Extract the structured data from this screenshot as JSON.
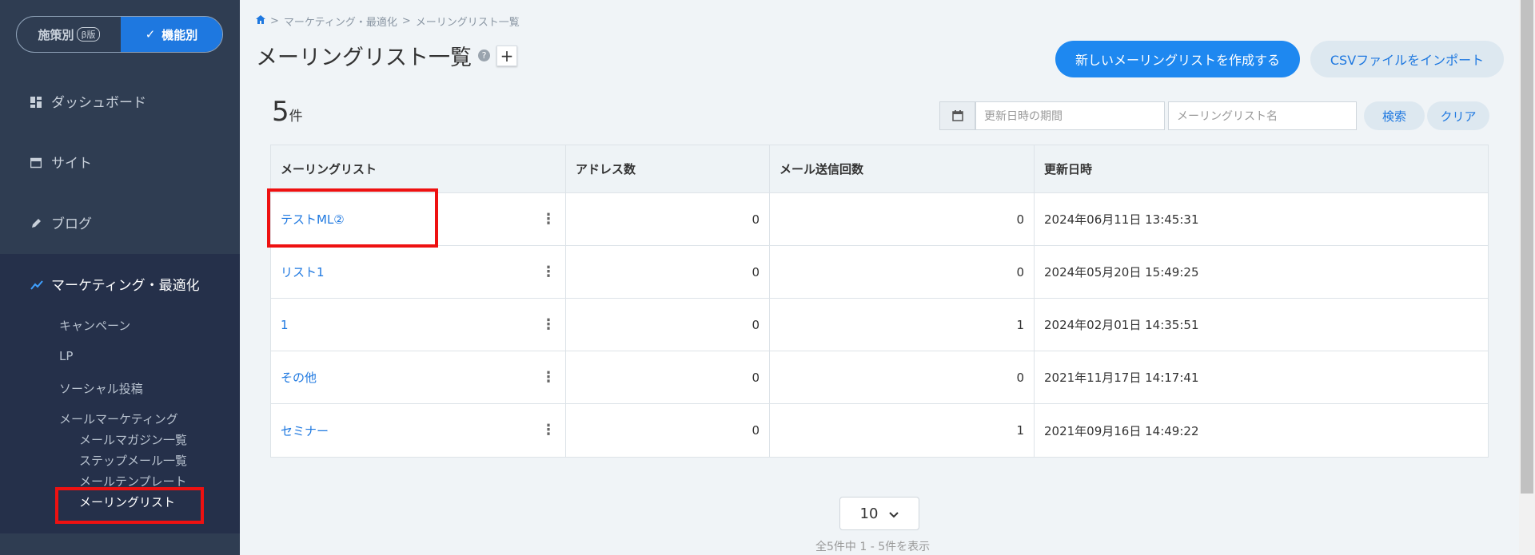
{
  "sidebar": {
    "segment": {
      "left_label": "施策別",
      "beta": "β版",
      "right_label": "機能別",
      "check": "✓"
    },
    "nav": [
      {
        "label": "ダッシュボード"
      },
      {
        "label": "サイト"
      },
      {
        "label": "ブログ"
      },
      {
        "label": "マーケティング・最適化"
      }
    ],
    "subnav": {
      "campaign": "キャンペーン",
      "lp": "LP",
      "social": "ソーシャル投稿",
      "mail_marketing": "メールマーケティング",
      "magazine": "メールマガジン一覧",
      "step": "ステップメール一覧",
      "template": "メールテンプレート",
      "mailing_list": "メーリングリスト"
    }
  },
  "breadcrumb": {
    "home_icon": "home-icon",
    "sep": ">",
    "level1": "マーケティング・最適化",
    "level2": "メーリングリスト一覧"
  },
  "page": {
    "title": "メーリングリスト一覧",
    "help": "?",
    "plus": "+",
    "create_button": "新しいメーリングリストを作成する",
    "import_button": "CSVファイルをインポート",
    "count": "5",
    "count_unit": "件"
  },
  "filters": {
    "date_placeholder": "更新日時の期間",
    "name_placeholder": "メーリングリスト名",
    "search": "検索",
    "clear": "クリア"
  },
  "table": {
    "headers": [
      "メーリングリスト",
      "アドレス数",
      "メール送信回数",
      "更新日時"
    ],
    "rows": [
      {
        "name": "テストML②",
        "addresses": "0",
        "sends": "0",
        "updated": "2024年06月11日  13:45:31"
      },
      {
        "name": "リスト1",
        "addresses": "0",
        "sends": "0",
        "updated": "2024年05月20日  15:49:25"
      },
      {
        "name": "1",
        "addresses": "0",
        "sends": "1",
        "updated": "2024年02月01日  14:35:51"
      },
      {
        "name": "その他",
        "addresses": "0",
        "sends": "0",
        "updated": "2021年11月17日  14:17:41"
      },
      {
        "name": "セミナー",
        "addresses": "0",
        "sends": "1",
        "updated": "2021年09月16日  14:49:22"
      }
    ],
    "kebab": "⋮"
  },
  "pager": {
    "per_page": "10",
    "info": "全5件中 1 - 5件を表示"
  },
  "colors": {
    "sidebar": "#2f3d52",
    "accent": "#1e88f0",
    "highlight": "#ee1111"
  }
}
